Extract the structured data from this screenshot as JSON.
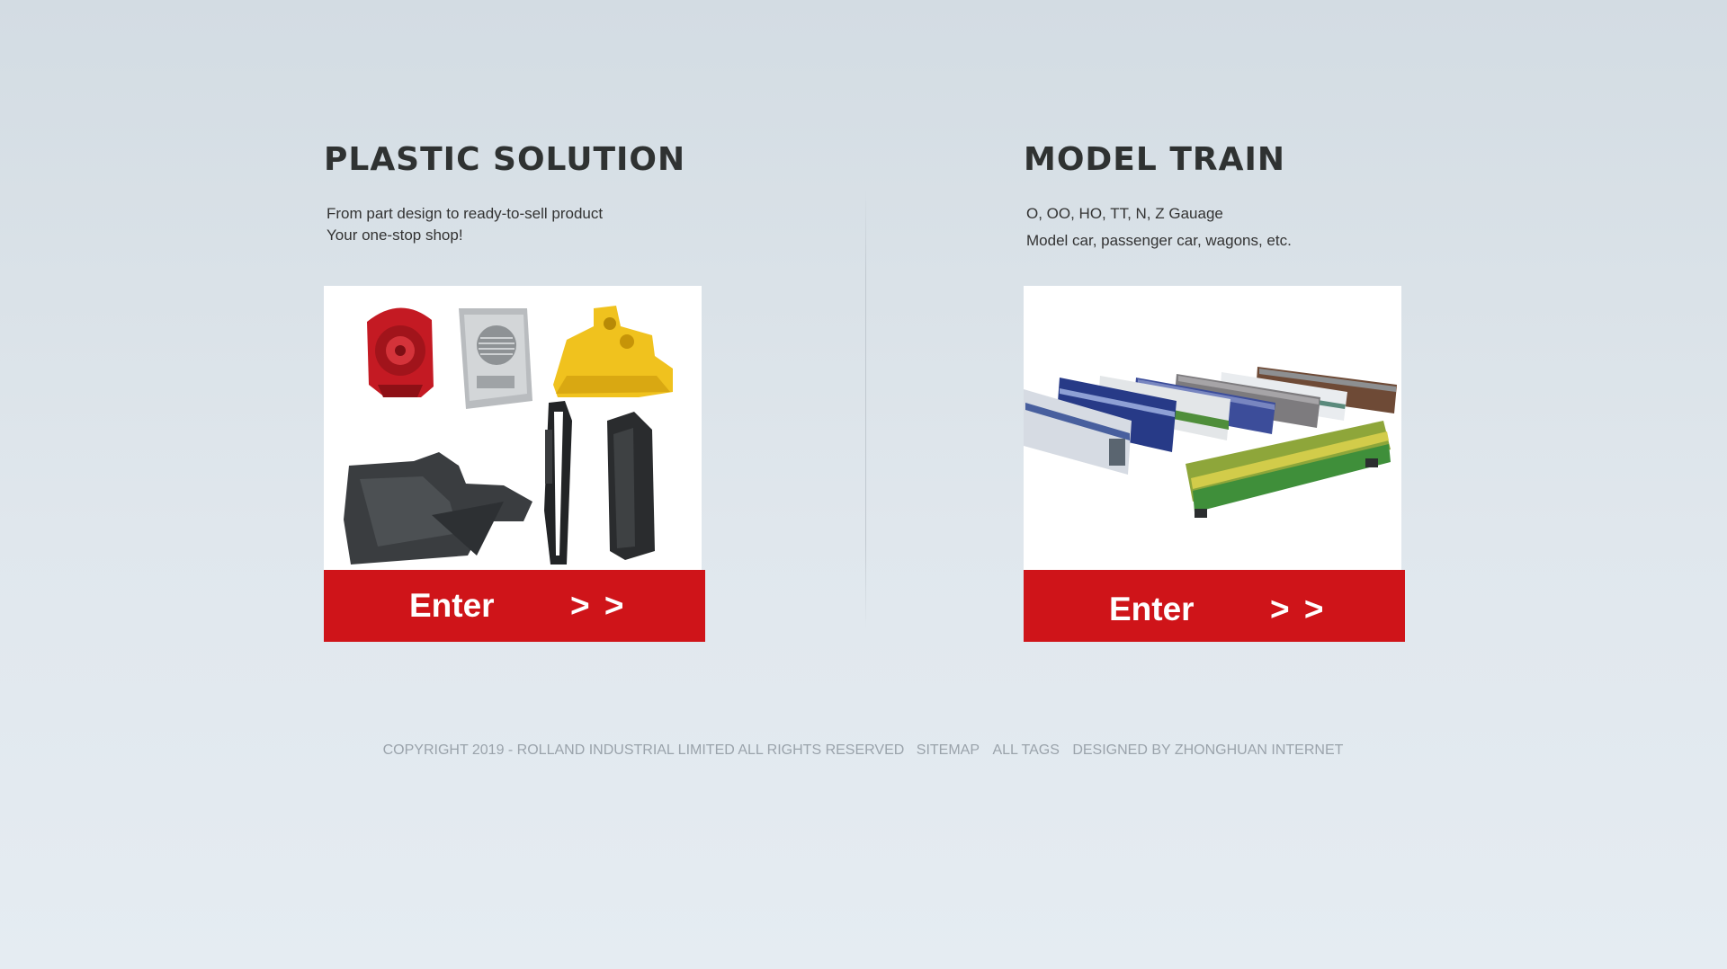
{
  "plastic": {
    "title": "PLASTIC SOLUTION",
    "line1": "From part design to ready-to-sell product",
    "line2": "Your one-stop shop!",
    "enter_label": "Enter",
    "enter_arrows": "> >"
  },
  "train": {
    "title": "MODEL TRAIN",
    "line1": "O, OO, HO, TT, N, Z Gauage",
    "line2": "Model car, passenger car, wagons, etc.",
    "enter_label": "Enter",
    "enter_arrows": "> >"
  },
  "footer": {
    "copyright": "COPYRIGHT  2019 - ROLLAND INDUSTRIAL LIMITED ALL RIGHTS RESERVED",
    "sitemap": "SITEMAP",
    "all_tags": "ALL TAGS",
    "designed_by": "DESIGNED BY ZHONGHUAN INTERNET"
  },
  "colors": {
    "enter_button": "#cf1419",
    "title_text": "#2f3232",
    "footer_text": "#9aa3ab"
  }
}
